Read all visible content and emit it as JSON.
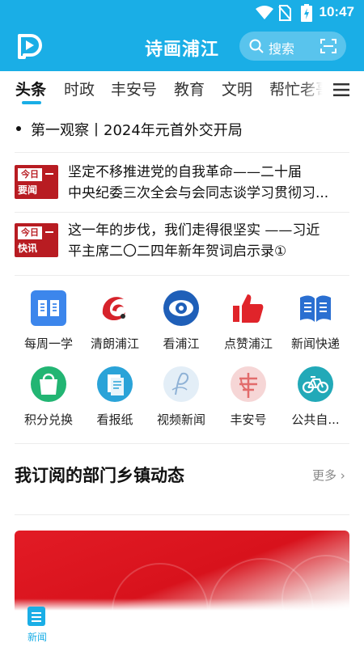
{
  "status_bar": {
    "time": "10:47"
  },
  "header": {
    "app_title": "诗画浦江",
    "search_placeholder": "搜索"
  },
  "tabs": [
    {
      "label": "头条",
      "active": true
    },
    {
      "label": "时政"
    },
    {
      "label": "丰安号"
    },
    {
      "label": "教育"
    },
    {
      "label": "文明"
    },
    {
      "label": "帮忙老哥"
    }
  ],
  "headline": {
    "text": "第一观察丨2024年元首外交开局"
  },
  "news": [
    {
      "badge_top": "今日",
      "badge_bottom": "要闻",
      "lines": [
        "坚定不移推进党的自我革命——二十届",
        "中央纪委三次全会与会同志谈学习贯彻习..."
      ]
    },
    {
      "badge_top": "今日",
      "badge_bottom": "快讯",
      "lines": [
        "这一年的步伐，我们走得很坚实 ——习近",
        "平主席二〇二四年新年贺词启示录①"
      ]
    }
  ],
  "services": [
    {
      "label": "每周一学",
      "icon": "book-icon",
      "color": "#2f7be5"
    },
    {
      "label": "清朗浦江",
      "icon": "swirl-logo-icon",
      "color": "#d62727"
    },
    {
      "label": "看浦江",
      "icon": "eye-icon",
      "color": "#1f5fb8"
    },
    {
      "label": "点赞浦江",
      "icon": "thumbs-up-icon",
      "color": "#e0242a"
    },
    {
      "label": "新闻快递",
      "icon": "open-book-icon",
      "color": "#2a6fd1"
    },
    {
      "label": "积分兑换",
      "icon": "shopping-bag-icon",
      "color": "#22b573"
    },
    {
      "label": "看报纸",
      "icon": "newspaper-icon",
      "color": "#2aa3d8"
    },
    {
      "label": "视频新闻",
      "icon": "video-p-icon",
      "color": "#8fb2d6"
    },
    {
      "label": "丰安号",
      "icon": "fengan-icon",
      "color": "#e67e7e"
    },
    {
      "label": "公共自...",
      "icon": "bicycle-icon",
      "color": "#22a9b8"
    }
  ],
  "section": {
    "title": "我订阅的部门乡镇动态",
    "more": "更多"
  },
  "bottom_nav": {
    "news_label": "新闻"
  }
}
